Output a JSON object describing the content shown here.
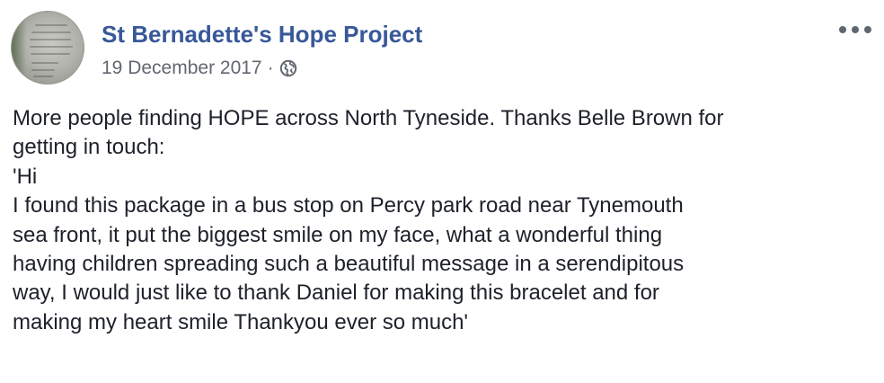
{
  "post": {
    "page_name": "St Bernadette's Hope Project",
    "date": "19 December 2017",
    "separator": "·",
    "audience_icon": "globe-icon",
    "more_icon": "more-options-icon",
    "lines": [
      "More people finding HOPE across North Tyneside. Thanks Belle Brown for",
      "getting in touch:",
      "'Hi",
      "I found this package in a bus stop on Percy park road near Tynemouth",
      "sea front, it put the biggest smile on my face, what a wonderful thing",
      "having children spreading such a beautiful message in a serendipitous",
      "way, I would just like to thank Daniel for making this bracelet and for",
      "making my heart smile Thankyou ever so much'"
    ]
  },
  "colors": {
    "page_name": "#385898",
    "meta": "#616770",
    "text": "#1d2129"
  }
}
